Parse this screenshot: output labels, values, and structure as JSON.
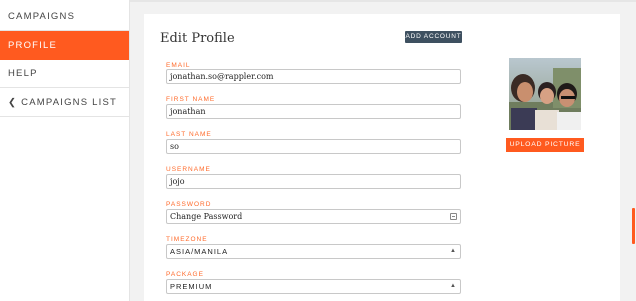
{
  "sidebar": {
    "items": [
      {
        "label": "CAMPAIGNS"
      },
      {
        "label": "PROFILE"
      },
      {
        "label": "HELP"
      },
      {
        "label": "CAMPAIGNS LIST",
        "icon": "chevron-left-icon"
      }
    ],
    "active": "PROFILE"
  },
  "page": {
    "title": "Edit Profile",
    "add_account_label": "ADD ACCOUNT",
    "upload_picture_label": "UPLOAD PICTURE"
  },
  "form": {
    "email": {
      "label": "EMAIL",
      "value": "jonathan.so@rappler.com"
    },
    "first_name": {
      "label": "FIRST NAME",
      "value": "jonathan"
    },
    "last_name": {
      "label": "LAST NAME",
      "value": "so"
    },
    "username": {
      "label": "USERNAME",
      "value": "jojo"
    },
    "password": {
      "label": "PASSWORD",
      "value": "Change Password"
    },
    "timezone": {
      "label": "TIMEZONE",
      "value": "ASIA/MANILA"
    },
    "package": {
      "label": "PACKAGE",
      "value": "PREMIUM"
    }
  },
  "colors": {
    "accent": "#ff5a1f",
    "label": "#ff6a2a",
    "button_dark": "#3e5060"
  }
}
